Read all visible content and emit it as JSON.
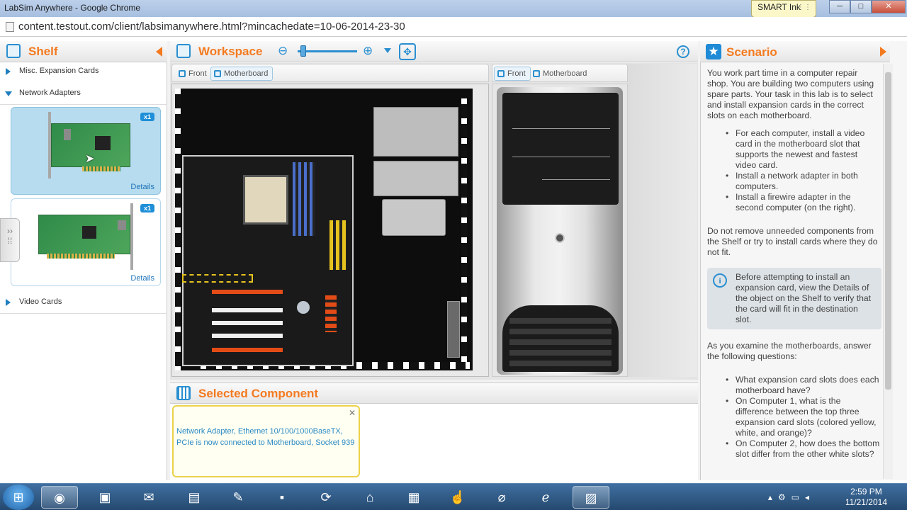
{
  "window": {
    "title": "LabSim Anywhere - Google Chrome",
    "minimize": "─",
    "maximize": "□",
    "close": "✕"
  },
  "smart_ink": {
    "label": "SMART Ink"
  },
  "address": {
    "url": "content.testout.com/client/labsimanywhere.html?mincachedate=10-06-2014-23-30"
  },
  "shelf": {
    "title": "Shelf",
    "categories": [
      {
        "label": "Misc. Expansion Cards",
        "expanded": false
      },
      {
        "label": "Network Adapters",
        "expanded": true
      },
      {
        "label": "Video Cards",
        "expanded": false
      }
    ],
    "items": [
      {
        "count": "x1",
        "details": "Details",
        "selected": true
      },
      {
        "count": "x1",
        "details": "Details",
        "selected": false
      }
    ]
  },
  "workspace": {
    "title": "Workspace",
    "zoom_level": 0.05,
    "computer1": {
      "tabs": [
        "Front",
        "Motherboard"
      ],
      "active_tab": "Motherboard"
    },
    "computer2": {
      "tabs": [
        "Front",
        "Motherboard"
      ],
      "active_tab": "Front"
    }
  },
  "selected_component": {
    "title": "Selected Component",
    "message": "Network Adapter, Ethernet 10/100/1000BaseTX, PCIe is now connected to Motherboard, Socket 939",
    "close": "✕"
  },
  "scenario": {
    "title": "Scenario",
    "intro": "You work part time in a computer repair shop. You are building two computers using spare parts. Your task in this lab is to select and install expansion cards in the correct slots on each motherboard.",
    "tasks": [
      "For each computer, install a video card in the motherboard slot that supports the newest and fastest video card.",
      "Install a network adapter in both computers.",
      "Install a firewire adapter in the second computer (on the right)."
    ],
    "warning": "Do not remove unneeded components from the Shelf or try to install cards where they do not fit.",
    "note": "Before attempting to install an expansion card, view the Details of the object on the Shelf to verify that the card will fit in the destination slot.",
    "questions_intro": "As you examine the motherboards, answer the following questions:",
    "questions": [
      "What expansion card slots does each motherboard have?",
      "On Computer 1, what is the difference between the top three expansion card slots (colored yellow, white, and orange)?",
      "On Computer 2, how does the bottom slot differ from the other white slots?"
    ]
  },
  "taskbar": {
    "icons": [
      "windows-start-icon",
      "chrome-icon",
      "network-icon",
      "outlook-icon",
      "file-explorer-icon",
      "notepad-icon",
      "terminal-icon",
      "sync-icon",
      "mydrive-icon",
      "calculator-icon",
      "smart-hand-icon",
      "network-tool-icon",
      "internet-explorer-icon",
      "labsim-icon"
    ],
    "time": "2:59 PM",
    "date": "11/21/2014"
  },
  "colors": {
    "accent": "#f47a1f",
    "blue": "#1f8ad6",
    "selected_card": "#b7dcef"
  }
}
